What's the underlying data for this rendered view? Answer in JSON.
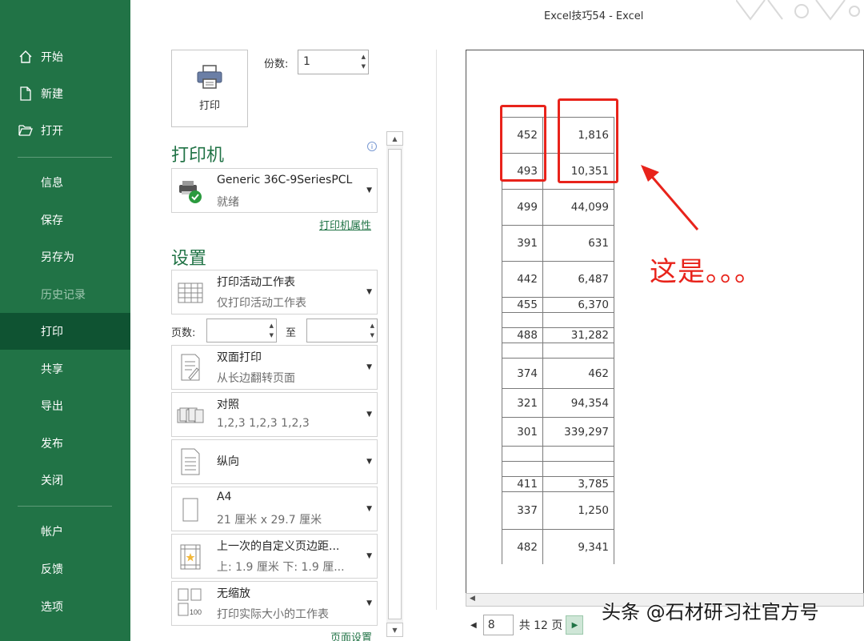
{
  "window": {
    "title": "Excel技巧54  -  Excel"
  },
  "sidebar": {
    "items": [
      {
        "label": "开始",
        "icon": "home-icon"
      },
      {
        "label": "新建",
        "icon": "new-document-icon"
      },
      {
        "label": "打开",
        "icon": "folder-open-icon"
      },
      {
        "label": "信息"
      },
      {
        "label": "保存"
      },
      {
        "label": "另存为"
      },
      {
        "label": "历史记录",
        "disabled": true
      },
      {
        "label": "打印",
        "active": true
      },
      {
        "label": "共享"
      },
      {
        "label": "导出"
      },
      {
        "label": "发布"
      },
      {
        "label": "关闭"
      },
      {
        "label": "帐户"
      },
      {
        "label": "反馈"
      },
      {
        "label": "选项"
      }
    ]
  },
  "print": {
    "button_label": "打印",
    "copies_label": "份数:",
    "copies_value": "1"
  },
  "printer": {
    "heading": "打印机",
    "name": "Generic 36C-9SeriesPCL",
    "status": "就绪",
    "properties_link": "打印机属性"
  },
  "settings": {
    "heading": "设置",
    "what": {
      "title": "打印活动工作表",
      "subtitle": "仅打印活动工作表"
    },
    "pages_label": "页数:",
    "to_label": "至",
    "pages_from": "",
    "pages_to": "",
    "sides": {
      "title": "双面打印",
      "subtitle": "从长边翻转页面"
    },
    "collate": {
      "title": "对照",
      "subtitle": "1,2,3    1,2,3    1,2,3"
    },
    "orientation": {
      "title": "纵向"
    },
    "paper": {
      "title": "A4",
      "subtitle": "21 厘米 x 29.7 厘米"
    },
    "margins": {
      "title": "上一次的自定义页边距...",
      "subtitle": "上: 1.9 厘米 下: 1.9 厘..."
    },
    "scaling": {
      "title": "无缩放",
      "subtitle": "打印实际大小的工作表"
    },
    "page_setup_link": "页面设置"
  },
  "preview": {
    "rows": [
      {
        "a": "452",
        "b": "1,816"
      },
      {
        "a": "493",
        "b": "10,351"
      },
      {
        "a": "499",
        "b": "44,099"
      },
      {
        "a": "391",
        "b": "631"
      },
      {
        "a": "442",
        "b": "6,487"
      },
      {
        "a": "455",
        "b": "6,370"
      },
      {
        "a": "",
        "b": ""
      },
      {
        "a": "488",
        "b": "31,282"
      },
      {
        "a": "",
        "b": ""
      },
      {
        "a": "374",
        "b": "462"
      },
      {
        "a": "321",
        "b": "94,354"
      },
      {
        "a": "301",
        "b": "339,297"
      },
      {
        "a": "",
        "b": ""
      },
      {
        "a": "",
        "b": ""
      },
      {
        "a": "411",
        "b": "3,785"
      },
      {
        "a": "337",
        "b": "1,250"
      },
      {
        "a": "482",
        "b": "9,341"
      }
    ],
    "annotation": "这是。。。",
    "annotation_color": "#e8231b"
  },
  "page_nav": {
    "current": "8",
    "total_label": "共 12 页"
  },
  "watermark": "头条 @石材研习社官方号",
  "colors": {
    "accent": "#217346",
    "sidebar_active": "#0f5332"
  }
}
